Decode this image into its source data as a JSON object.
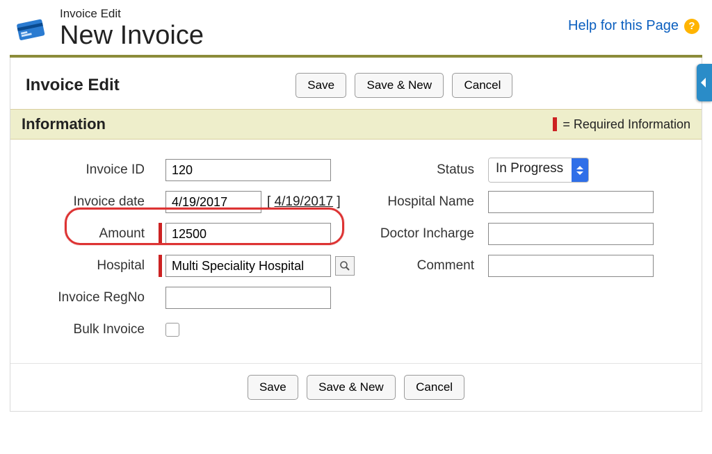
{
  "header": {
    "breadcrumb": "Invoice Edit",
    "title": "New Invoice"
  },
  "help": {
    "label": "Help for this Page"
  },
  "panel": {
    "title": "Invoice Edit"
  },
  "buttons": {
    "save": "Save",
    "save_new": "Save & New",
    "cancel": "Cancel"
  },
  "section": {
    "title": "Information",
    "required_note": "= Required Information"
  },
  "left": {
    "invoice_id": {
      "label": "Invoice ID",
      "value": "120"
    },
    "invoice_date": {
      "label": "Invoice date",
      "value": "4/19/2017",
      "link": "4/19/2017"
    },
    "amount": {
      "label": "Amount",
      "value": "12500"
    },
    "hospital": {
      "label": "Hospital",
      "value": "Multi Speciality Hospital"
    },
    "regno": {
      "label": "Invoice RegNo",
      "value": ""
    },
    "bulk": {
      "label": "Bulk Invoice"
    }
  },
  "right": {
    "status": {
      "label": "Status",
      "value": "In Progress"
    },
    "hospital_name": {
      "label": "Hospital Name",
      "value": ""
    },
    "doctor": {
      "label": "Doctor Incharge",
      "value": ""
    },
    "comment": {
      "label": "Comment",
      "value": ""
    }
  }
}
